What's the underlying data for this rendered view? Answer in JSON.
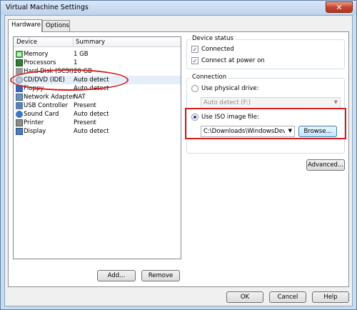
{
  "window": {
    "title": "Virtual Machine Settings",
    "close_glyph": "✕"
  },
  "tabs": [
    {
      "label": "Hardware",
      "active": true
    },
    {
      "label": "Options",
      "active": false
    }
  ],
  "device_list": {
    "col_device": "Device",
    "col_summary": "Summary",
    "rows": [
      {
        "name": "Memory",
        "summary": "1 GB",
        "icon": "memory-icon"
      },
      {
        "name": "Processors",
        "summary": "1",
        "icon": "processor-icon"
      },
      {
        "name": "Hard Disk (SCSI)",
        "summary": "20 GB",
        "icon": "hard-disk-icon"
      },
      {
        "name": "CD/DVD (IDE)",
        "summary": "Auto detect",
        "icon": "cd-dvd-icon",
        "selected": true
      },
      {
        "name": "Floppy",
        "summary": "Auto detect",
        "icon": "floppy-icon"
      },
      {
        "name": "Network Adapter",
        "summary": "NAT",
        "icon": "network-adapter-icon"
      },
      {
        "name": "USB Controller",
        "summary": "Present",
        "icon": "usb-icon"
      },
      {
        "name": "Sound Card",
        "summary": "Auto detect",
        "icon": "sound-card-icon"
      },
      {
        "name": "Printer",
        "summary": "Present",
        "icon": "printer-icon"
      },
      {
        "name": "Display",
        "summary": "Auto detect",
        "icon": "display-icon"
      }
    ],
    "add_label": "Add...",
    "remove_label": "Remove"
  },
  "device_status": {
    "legend": "Device status",
    "connected_label": "Connected",
    "connected_checked": true,
    "connect_power_label": "Connect at power on",
    "connect_power_checked": true
  },
  "connection": {
    "legend": "Connection",
    "physical_label": "Use physical drive:",
    "physical_value": "Auto detect (F:)",
    "iso_label": "Use ISO image file:",
    "iso_value": "C:\\Downloads\\WindowsDevelop",
    "browse_label": "Browse...",
    "advanced_label": "Advanced..."
  },
  "footer": {
    "ok_label": "OK",
    "cancel_label": "Cancel",
    "help_label": "Help"
  },
  "colors": {
    "annotation_red": "#d61f1f",
    "selection": "#e5eef9"
  }
}
